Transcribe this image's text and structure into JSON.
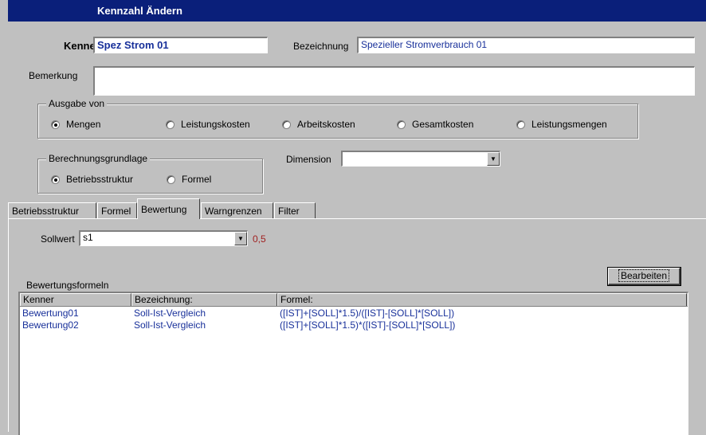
{
  "window": {
    "title": "Kennzahl Ändern"
  },
  "form": {
    "kenner_label": "Kenner",
    "kenner_value": "Spez Strom 01",
    "bezeichnung_label": "Bezeichnung",
    "bezeichnung_value": "Spezieller Stromverbrauch 01",
    "bemerkung_label": "Bemerkung",
    "bemerkung_value": ""
  },
  "ausgabe": {
    "legend": "Ausgabe von",
    "options": [
      {
        "label": "Mengen",
        "selected": true
      },
      {
        "label": "Leistungskosten",
        "selected": false
      },
      {
        "label": "Arbeitskosten",
        "selected": false
      },
      {
        "label": "Gesamtkosten",
        "selected": false
      },
      {
        "label": "Leistungsmengen",
        "selected": false
      }
    ]
  },
  "berechnung": {
    "legend": "Berechnungsgrundlage",
    "options": [
      {
        "label": "Betriebsstruktur",
        "selected": true
      },
      {
        "label": "Formel",
        "selected": false
      }
    ]
  },
  "dimension": {
    "label": "Dimension",
    "value": ""
  },
  "tabs": [
    {
      "label": "Betriebsstruktur",
      "active": false
    },
    {
      "label": "Formel",
      "active": false
    },
    {
      "label": "Bewertung",
      "active": true
    },
    {
      "label": "Warngrenzen",
      "active": false
    },
    {
      "label": "Filter",
      "active": false
    }
  ],
  "bewertung": {
    "sollwert_label": "Sollwert",
    "sollwert_value": "s1",
    "sollwert_number": "0,5",
    "sollwert_number_color": "#a02020",
    "formeln_label": "Bewertungsformeln",
    "edit_button": "Bearbeiten",
    "columns": [
      "Kenner",
      "Bezeichnung:",
      "Formel:"
    ],
    "rows": [
      [
        "Bewertung01",
        "Soll-Ist-Vergleich",
        "([IST]+[SOLL]*1.5)/([IST]-[SOLL]*[SOLL])"
      ],
      [
        "Bewertung02",
        "Soll-Ist-Vergleich",
        "([IST]+[SOLL]*1.5)*([IST]-[SOLL]*[SOLL])"
      ]
    ]
  },
  "colors": {
    "title_bar": "#0a1f7a",
    "value_text": "#18309a",
    "dialog_bg": "#c0c0c0"
  }
}
